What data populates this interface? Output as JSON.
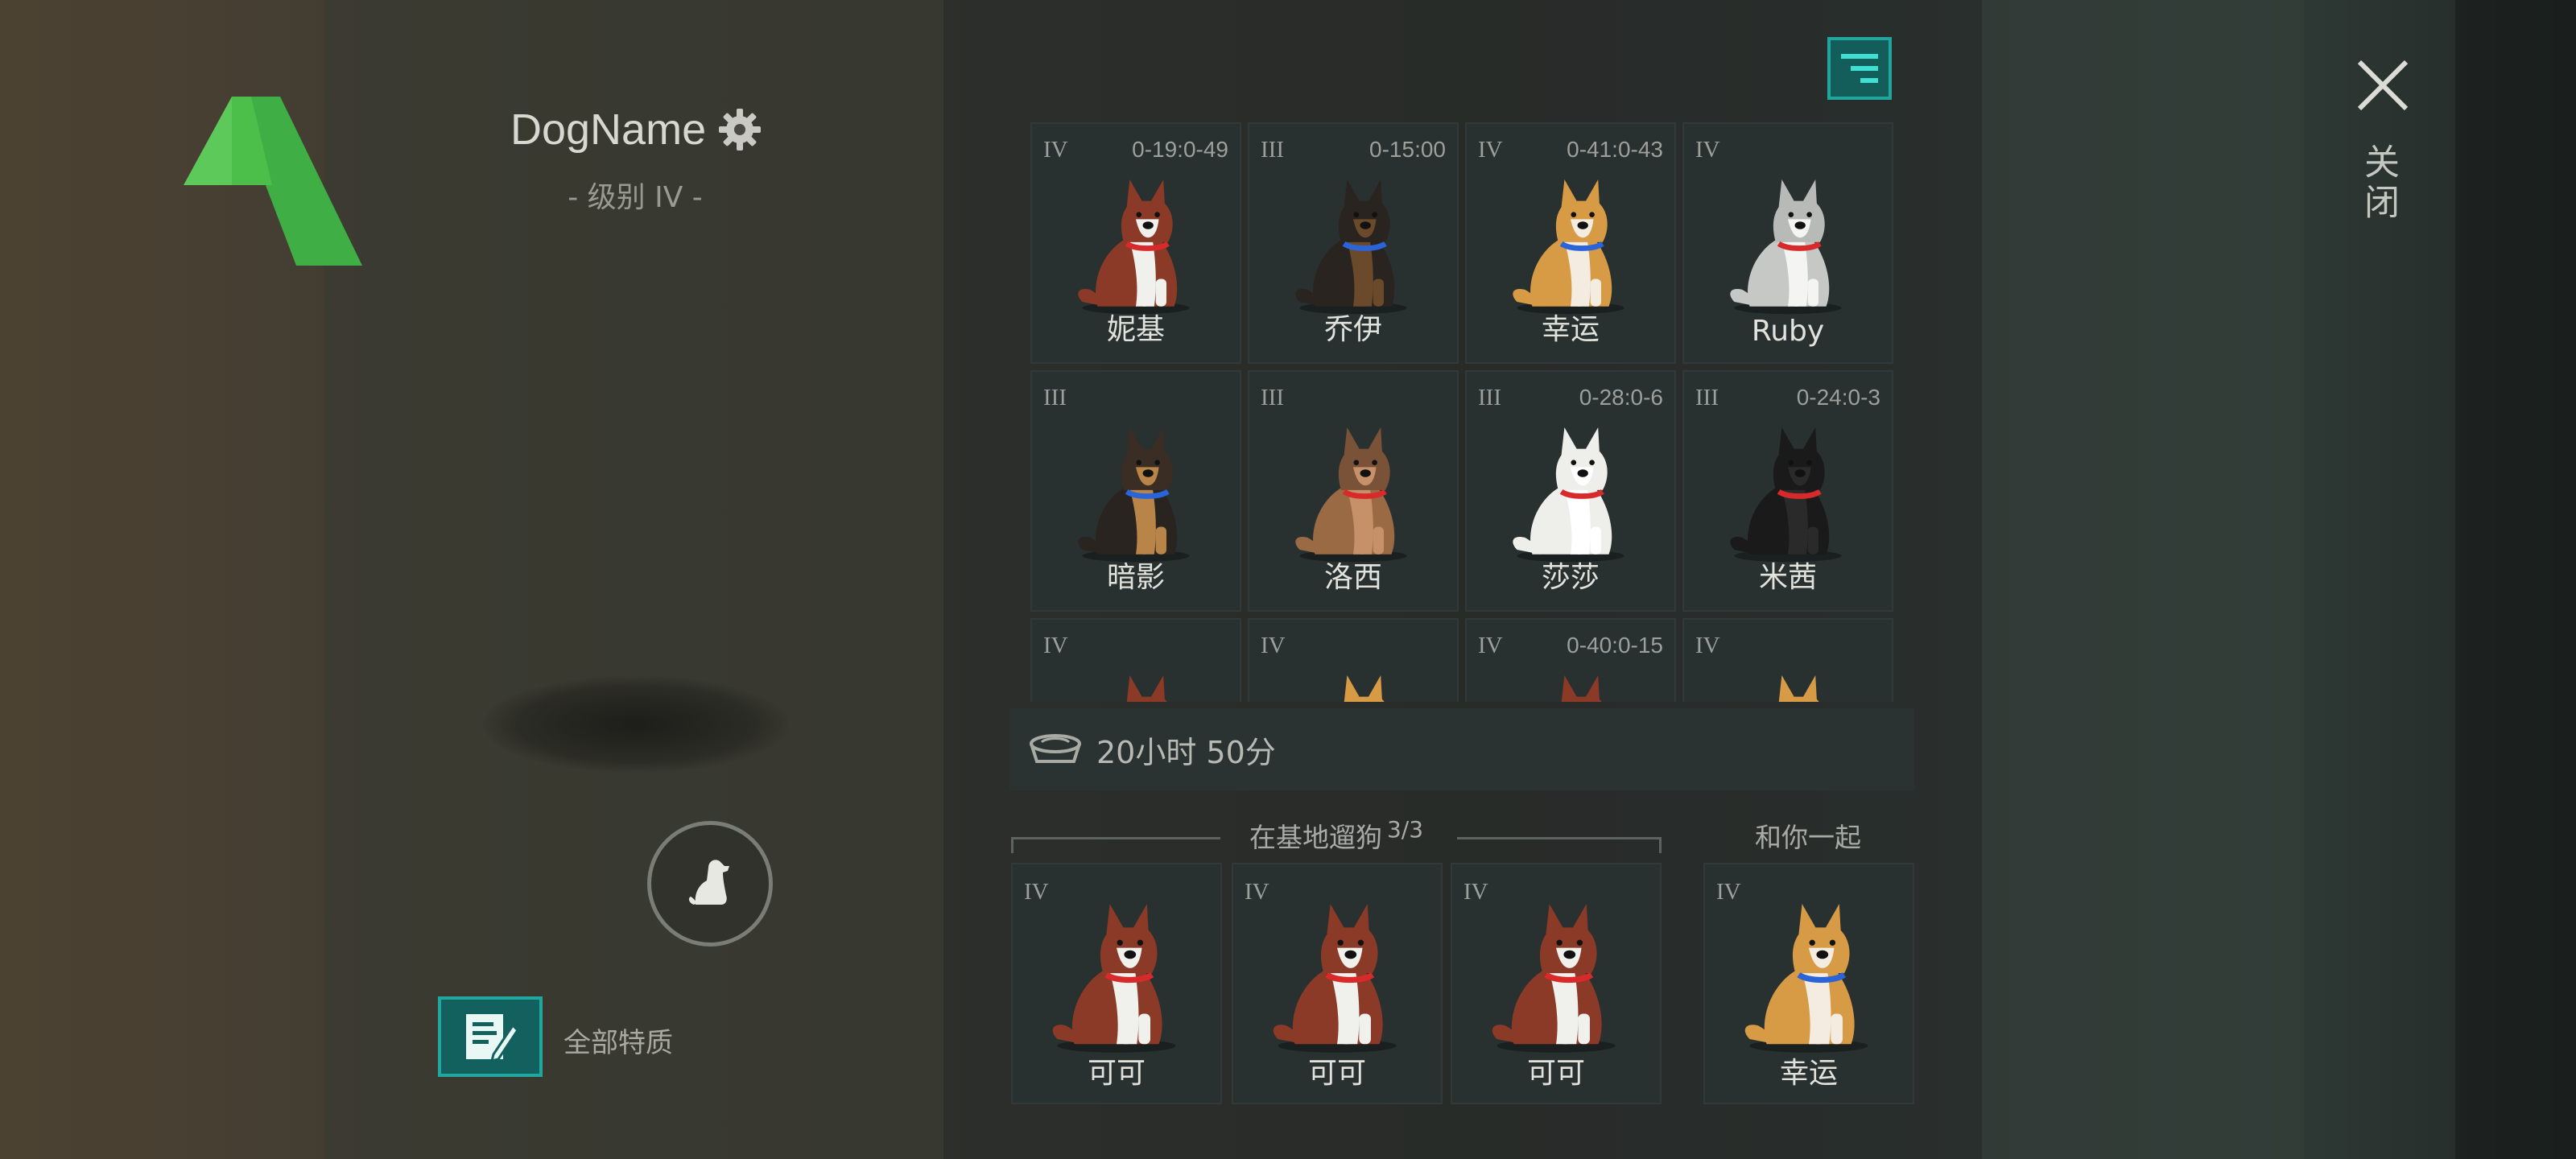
{
  "profile": {
    "dog_name": "DogName",
    "level_label": "- 级别 IV -",
    "traits_label": "全部特质"
  },
  "close_label": "关闭",
  "colors": {
    "accent_teal": "#1fa7a0",
    "logo_green": "#4cbe4a"
  },
  "icons": {
    "logo": "green-a-logo",
    "settings": "gear-icon",
    "filter": "filter-lines-icon",
    "pet": "sitting-dog-icon",
    "traits": "notes-pen-icon",
    "food": "food-bowl-icon",
    "close": "close-x-icon"
  },
  "kennel": {
    "dogs": [
      {
        "level": "IV",
        "timer": "0-19:0-49",
        "name": "妮基",
        "breed": "husky"
      },
      {
        "level": "III",
        "timer": "0-15:00",
        "name": "乔伊",
        "breed": "black-puppy"
      },
      {
        "level": "IV",
        "timer": "0-41:0-43",
        "name": "幸运",
        "breed": "corgi"
      },
      {
        "level": "IV",
        "timer": "",
        "name": "Ruby",
        "breed": "white-husky"
      },
      {
        "level": "III",
        "timer": "",
        "name": "暗影",
        "breed": "shepherd-dark"
      },
      {
        "level": "III",
        "timer": "",
        "name": "洛西",
        "breed": "shepherd-tan"
      },
      {
        "level": "III",
        "timer": "0-28:0-6",
        "name": "莎莎",
        "breed": "white-puppy"
      },
      {
        "level": "III",
        "timer": "0-24:0-3",
        "name": "米茜",
        "breed": "black-pug"
      },
      {
        "level": "IV",
        "timer": "",
        "name": "",
        "breed": "husky"
      },
      {
        "level": "IV",
        "timer": "",
        "name": "",
        "breed": "corgi"
      },
      {
        "level": "IV",
        "timer": "0-40:0-15",
        "name": "",
        "breed": "husky"
      },
      {
        "level": "IV",
        "timer": "",
        "name": "",
        "breed": "corgi"
      }
    ]
  },
  "food": {
    "time_left": "20小时 50分"
  },
  "walk": {
    "title": "在基地遛狗",
    "count": "3/3",
    "dogs": [
      {
        "level": "IV",
        "name": "可可",
        "breed": "husky"
      },
      {
        "level": "IV",
        "name": "可可",
        "breed": "husky"
      },
      {
        "level": "IV",
        "name": "可可",
        "breed": "husky"
      }
    ]
  },
  "companion": {
    "title": "和你一起",
    "dog": {
      "level": "IV",
      "name": "幸运",
      "breed": "corgi"
    }
  }
}
